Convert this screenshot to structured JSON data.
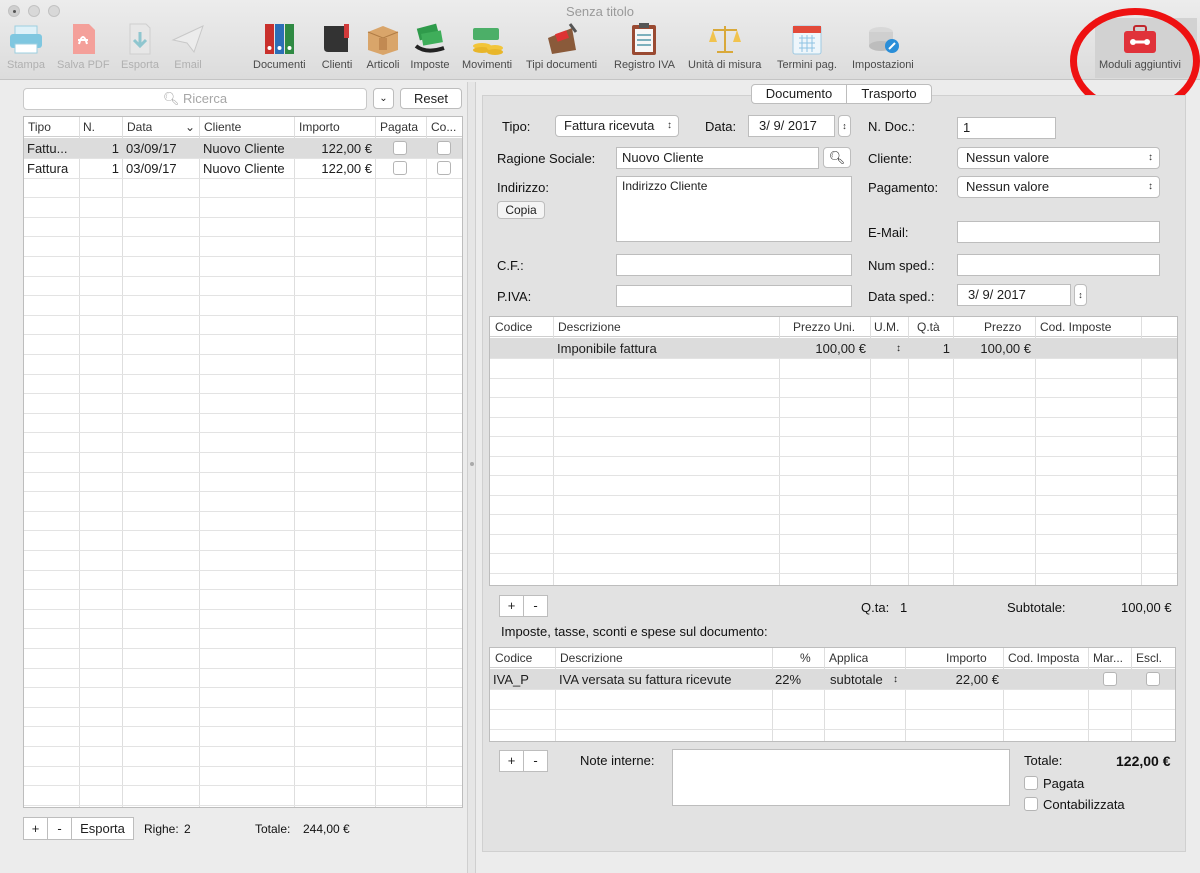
{
  "window": {
    "title": "Senza titolo"
  },
  "toolbar": [
    {
      "label": "Stampa",
      "icon": "printer-icon",
      "enabled": false
    },
    {
      "label": "Salva PDF",
      "icon": "pdf-icon",
      "enabled": false
    },
    {
      "label": "Esporta",
      "icon": "export-icon",
      "enabled": false
    },
    {
      "label": "Email",
      "icon": "paper-plane-icon",
      "enabled": false
    },
    {
      "label": "Documenti",
      "icon": "binders-icon",
      "enabled": true
    },
    {
      "label": "Clienti",
      "icon": "book-icon",
      "enabled": true
    },
    {
      "label": "Articoli",
      "icon": "box-icon",
      "enabled": true
    },
    {
      "label": "Imposte",
      "icon": "money-hand-icon",
      "enabled": true
    },
    {
      "label": "Movimenti",
      "icon": "coins-icon",
      "enabled": true
    },
    {
      "label": "Tipi documenti",
      "icon": "stamp-icon",
      "enabled": true
    },
    {
      "label": "Registro IVA",
      "icon": "clipboard-icon",
      "enabled": true
    },
    {
      "label": "Unità di misura",
      "icon": "scales-icon",
      "enabled": true
    },
    {
      "label": "Termini pag.",
      "icon": "calendar-icon",
      "enabled": true
    },
    {
      "label": "Impostazioni",
      "icon": "settings-disk-icon",
      "enabled": true
    },
    {
      "label": "Moduli aggiuntivi",
      "icon": "toolbox-icon",
      "enabled": true
    }
  ],
  "colors": {
    "annotation_circle": "#ee1111"
  },
  "list": {
    "search_placeholder": "Ricerca",
    "reset_label": "Reset",
    "columns": [
      "Tipo",
      "N.",
      "Data",
      "Cliente",
      "Importo",
      "Pagata",
      "Co..."
    ],
    "rows": [
      {
        "tipo": "Fattu...",
        "n": "1",
        "data": "03/09/17",
        "cliente": "Nuovo Cliente",
        "importo": "122,00 €"
      },
      {
        "tipo": "Fattura",
        "n": "1",
        "data": "03/09/17",
        "cliente": "Nuovo Cliente",
        "importo": "122,00 €"
      }
    ],
    "add_label": "+",
    "remove_label": "-",
    "export_label": "Esporta",
    "rows_label": "Righe:",
    "rows_count": "2",
    "total_label": "Totale:",
    "total_value": "244,00 €"
  },
  "tabs": [
    "Documento",
    "Trasporto"
  ],
  "form": {
    "tipo_label": "Tipo:",
    "tipo_value": "Fattura ricevuta",
    "data_label": "Data:",
    "data_value": "3/ 9/ 2017",
    "ndoc_label": "N. Doc.:",
    "ndoc_value": "1",
    "ragione_label": "Ragione Sociale:",
    "ragione_value": "Nuovo Cliente",
    "cliente_label": "Cliente:",
    "cliente_value": "Nessun valore",
    "indirizzo_label": "Indirizzo:",
    "indirizzo_value": "Indirizzo Cliente",
    "copia_label": "Copia",
    "pagamento_label": "Pagamento:",
    "pagamento_value": "Nessun valore",
    "email_label": "E-Mail:",
    "cf_label": "C.F.:",
    "numsped_label": "Num sped.:",
    "piva_label": "P.IVA:",
    "datasped_label": "Data sped.:",
    "datasped_value": "3/ 9/ 2017"
  },
  "items": {
    "columns": [
      "Codice",
      "Descrizione",
      "Prezzo Uni.",
      "U.M.",
      "Q.tà",
      "Prezzo",
      "Cod. Imposte"
    ],
    "rows": [
      {
        "codice": "",
        "descrizione": "Imponibile fattura",
        "prezzo_uni": "100,00 €",
        "qta": "1",
        "prezzo": "100,00 €"
      }
    ],
    "qta_label": "Q.ta:",
    "qta_value": "1",
    "subtotale_label": "Subtotale:",
    "subtotale_value": "100,00 €"
  },
  "taxes": {
    "heading": "Imposte, tasse, sconti e spese sul documento:",
    "columns": [
      "Codice",
      "Descrizione",
      "%",
      "Applica",
      "Importo",
      "Cod. Imposta",
      "Mar...",
      "Escl."
    ],
    "rows": [
      {
        "codice": "IVA_P",
        "descrizione": "IVA versata su fattura ricevute",
        "perc": "22%",
        "applica": "subtotale",
        "importo": "22,00 €"
      }
    ]
  },
  "footer": {
    "note_label": "Note interne:",
    "totale_label": "Totale:",
    "totale_value": "122,00 €",
    "pagata_label": "Pagata",
    "contab_label": "Contabilizzata"
  }
}
